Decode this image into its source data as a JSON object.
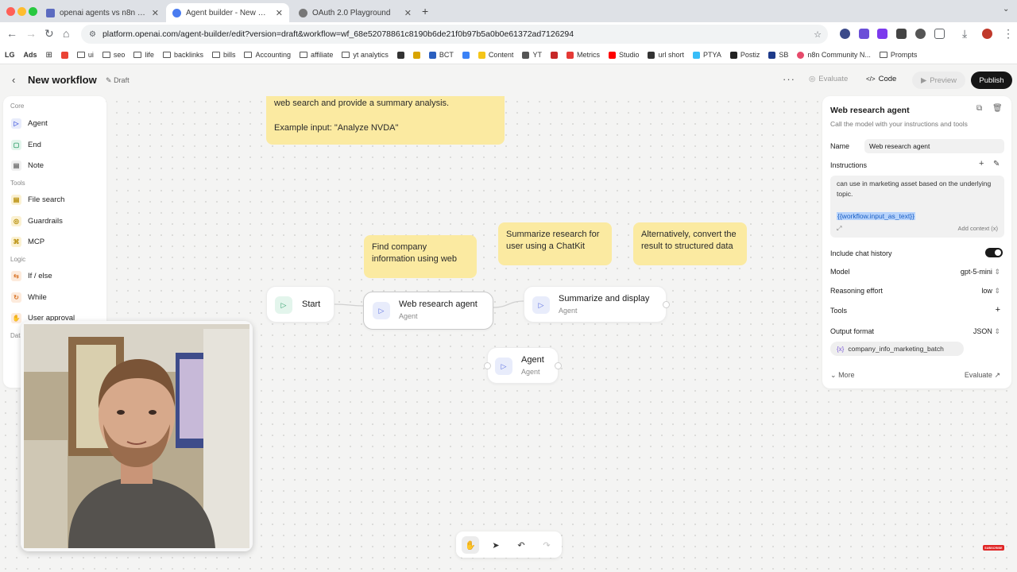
{
  "browser": {
    "tabs": [
      {
        "title": "openai agents vs n8n – Exca",
        "active": false,
        "favicon_color": "#5c6bc0"
      },
      {
        "title": "Agent builder - New workflow",
        "active": true,
        "favicon_color": "#4a7cf0"
      },
      {
        "title": "OAuth 2.0 Playground",
        "active": false,
        "favicon_color": "#777777"
      }
    ],
    "url": "platform.openai.com/agent-builder/edit?version=draft&workflow=wf_68e52078861c8190b6de21f0b97b5a0b0e61372ad7126294",
    "bookmarks": [
      "LG",
      "Ads",
      "",
      "ui",
      "seo",
      "life",
      "backlinks",
      "bills",
      "Accounting",
      "affiliate",
      "yt analytics",
      "",
      "",
      "BCT",
      "",
      "Content",
      "YT",
      "",
      "Metrics",
      "Studio",
      "url short",
      "PTYA",
      "Postiz",
      "SB",
      "n8n Community N...",
      "Prompts"
    ]
  },
  "header": {
    "title": "New workflow",
    "draft_label": "Draft",
    "evaluate_label": "Evaluate",
    "code_label": "Code",
    "preview_label": "Preview",
    "publish_label": "Publish"
  },
  "sidebar": {
    "sections": [
      {
        "title": "Core",
        "items": [
          {
            "label": "Agent",
            "icon": "agent-icon",
            "color": "#5b6ee1",
            "bg": "#e8ecfb",
            "glyph": "▷"
          },
          {
            "label": "End",
            "icon": "end-icon",
            "color": "#2f9e6a",
            "bg": "#e3f5ec",
            "glyph": "▢"
          },
          {
            "label": "Note",
            "icon": "note-icon",
            "color": "#666666",
            "bg": "#f0f0f0",
            "glyph": "▤"
          }
        ]
      },
      {
        "title": "Tools",
        "items": [
          {
            "label": "File search",
            "icon": "file-search-icon",
            "color": "#b58a00",
            "bg": "#fbf1d2",
            "glyph": "▤"
          },
          {
            "label": "Guardrails",
            "icon": "guardrails-icon",
            "color": "#b58a00",
            "bg": "#fbf1d2",
            "glyph": "◎"
          },
          {
            "label": "MCP",
            "icon": "mcp-icon",
            "color": "#b58a00",
            "bg": "#fbf1d2",
            "glyph": "⌘"
          }
        ]
      },
      {
        "title": "Logic",
        "items": [
          {
            "label": "If / else",
            "icon": "if-else-icon",
            "color": "#d9762a",
            "bg": "#fdebdc",
            "glyph": "⇆"
          },
          {
            "label": "While",
            "icon": "while-icon",
            "color": "#d9762a",
            "bg": "#fdebdc",
            "glyph": "↻"
          },
          {
            "label": "User approval",
            "icon": "user-approval-icon",
            "color": "#d9762a",
            "bg": "#fdebdc",
            "glyph": "✋"
          }
        ]
      }
    ],
    "data_section_partial": "Data"
  },
  "canvas": {
    "top_note": {
      "line1": "web search and provide a summary analysis.",
      "line2": "Example input: \"Analyze NVDA\""
    },
    "notes": [
      {
        "text": "Find company information using web"
      },
      {
        "text": "Summarize research for user using a ChatKit"
      },
      {
        "text": "Alternatively, convert the result to structured data"
      }
    ],
    "nodes": [
      {
        "title": "Start",
        "subtitle": ""
      },
      {
        "title": "Web research agent",
        "subtitle": "Agent"
      },
      {
        "title": "Summarize and display",
        "subtitle": "Agent"
      },
      {
        "title": "Agent",
        "subtitle": "Agent"
      }
    ]
  },
  "panel": {
    "title": "Web research agent",
    "description": "Call the model with your instructions and tools",
    "name_label": "Name",
    "name_value": "Web research agent",
    "instructions_label": "Instructions",
    "instructions_text": "can use in marketing asset based on the underlying topic.",
    "instructions_variable": "{{workflow.input_as_text}}",
    "add_context_label": "Add context",
    "include_history_label": "Include chat history",
    "include_history_on": true,
    "model_label": "Model",
    "model_value": "gpt-5-mini",
    "reasoning_label": "Reasoning effort",
    "reasoning_value": "low",
    "tools_label": "Tools",
    "output_format_label": "Output format",
    "output_format_value": "JSON",
    "schema_name": "company_info_marketing_batch",
    "more_label": "More",
    "evaluate_label": "Evaluate"
  },
  "overlay": {
    "subscribe_badge": "SUBSCRIBE"
  }
}
